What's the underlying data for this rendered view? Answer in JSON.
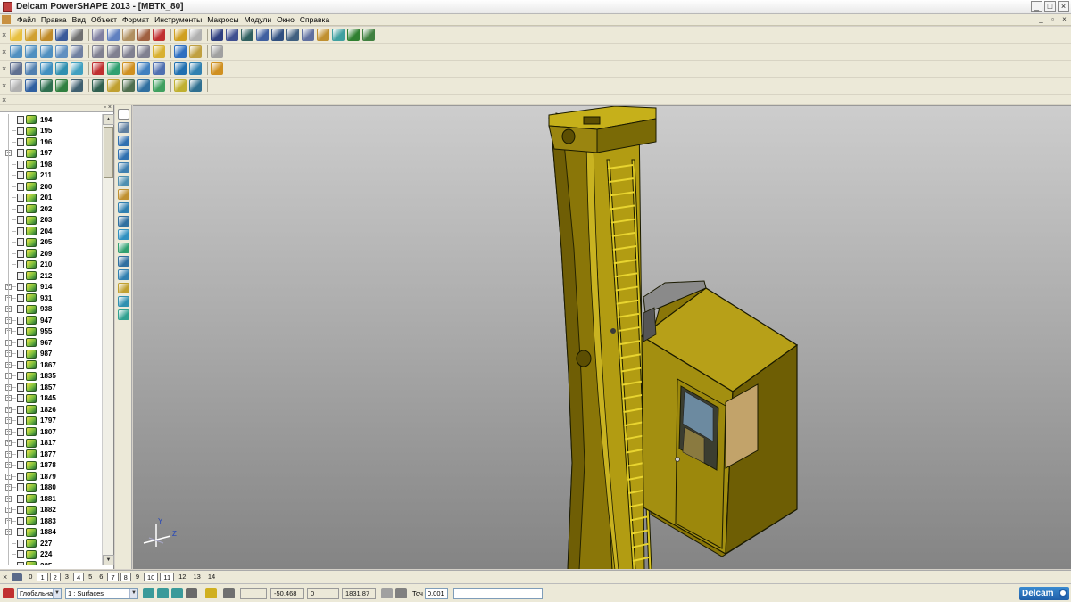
{
  "window": {
    "title": "Delcam PowerSHAPE 2013 - [МВТК_80]",
    "min": "_",
    "max": "□",
    "close": "×"
  },
  "menu": [
    "Файл",
    "Правка",
    "Вид",
    "Объект",
    "Формат",
    "Инструменты",
    "Макросы",
    "Модули",
    "Окно",
    "Справка"
  ],
  "mdi_controls": {
    "min": "_",
    "restore": "▫",
    "close": "×"
  },
  "toolbars": {
    "grip": "×",
    "row1_icons": [
      {
        "name": "new-icon",
        "color": "#e8c040"
      },
      {
        "name": "open-icon",
        "color": "#d0a030"
      },
      {
        "name": "open-recent-icon",
        "color": "#c08a28"
      },
      {
        "name": "save-icon",
        "color": "#3a5a9a"
      },
      {
        "name": "print-icon",
        "color": "#707070"
      },
      {
        "name": "cut-icon",
        "color": "#8080a0"
      },
      {
        "name": "copy-icon",
        "color": "#6080c0"
      },
      {
        "name": "paste-icon",
        "color": "#b09060"
      },
      {
        "name": "brush-icon",
        "color": "#a06040"
      },
      {
        "name": "delete-icon",
        "color": "#c03030"
      },
      {
        "name": "undo-icon",
        "color": "#d0a020"
      },
      {
        "name": "redo-icon",
        "color": "#b0b0b0"
      },
      {
        "name": "workplane-icon",
        "color": "#304080"
      },
      {
        "name": "measure-icon",
        "color": "#405090"
      },
      {
        "name": "axis-icon",
        "color": "#306060"
      },
      {
        "name": "select-icon",
        "color": "#4060a0"
      },
      {
        "name": "circle-icon",
        "color": "#305080"
      },
      {
        "name": "curve-icon",
        "color": "#406080"
      },
      {
        "name": "text-icon",
        "color": "#6070a0"
      },
      {
        "name": "fillet-icon",
        "color": "#c09030"
      },
      {
        "name": "surface-icon",
        "color": "#40a0a0"
      },
      {
        "name": "solid-icon",
        "color": "#308030"
      },
      {
        "name": "tools-icon",
        "color": "#408040"
      }
    ],
    "row2_icons": [
      {
        "name": "view-top-icon",
        "color": "#5090c0"
      },
      {
        "name": "view-front-icon",
        "color": "#5090c0"
      },
      {
        "name": "view-iso-icon",
        "color": "#5090c0"
      },
      {
        "name": "view-iso2-icon",
        "color": "#6090c0"
      },
      {
        "name": "view-fit-icon",
        "color": "#7080a0"
      },
      {
        "name": "zoom-in-icon",
        "color": "#808090"
      },
      {
        "name": "zoom-out-icon",
        "color": "#808090"
      },
      {
        "name": "zoom-box-icon",
        "color": "#808090"
      },
      {
        "name": "zoom-window-icon",
        "color": "#808090"
      },
      {
        "name": "shade-sphere-icon",
        "color": "#d8b030"
      },
      {
        "name": "shade-box-icon",
        "color": "#3070c0"
      },
      {
        "name": "shade-options-icon",
        "color": "#c0a040"
      },
      {
        "name": "hand-icon",
        "color": "#a0a0a0"
      }
    ],
    "row3_icons": [
      {
        "name": "model-tree-icon",
        "color": "#607090"
      },
      {
        "name": "document-icon",
        "color": "#5080b0"
      },
      {
        "name": "wireframe-icon",
        "color": "#4090c0"
      },
      {
        "name": "surface-shade-icon",
        "color": "#3090b0"
      },
      {
        "name": "solid-shade-icon",
        "color": "#40a0c0"
      },
      {
        "name": "red-ball-icon",
        "color": "#c03030"
      },
      {
        "name": "cone-icon",
        "color": "#30a070"
      },
      {
        "name": "cube-icon",
        "color": "#d09020"
      },
      {
        "name": "edges-icon",
        "color": "#4080c0"
      },
      {
        "name": "section-icon",
        "color": "#5070b0"
      },
      {
        "name": "transform-icon",
        "color": "#2070b0"
      },
      {
        "name": "mirror-icon",
        "color": "#3080b0"
      },
      {
        "name": "boolean-icon",
        "color": "#d09020"
      }
    ],
    "row4_icons": [
      {
        "name": "sphere-grey-icon",
        "color": "#b0b0b0"
      },
      {
        "name": "trim-icon",
        "color": "#3060a0"
      },
      {
        "name": "solid-box-icon",
        "color": "#307050"
      },
      {
        "name": "solid-extrude-icon",
        "color": "#308040"
      },
      {
        "name": "solid-revolve-icon",
        "color": "#406070"
      },
      {
        "name": "solid-blend-icon",
        "color": "#306050"
      },
      {
        "name": "solid-shell-icon",
        "color": "#c0a030"
      },
      {
        "name": "solid-pattern-icon",
        "color": "#507050"
      },
      {
        "name": "solid-array-icon",
        "color": "#3070a0"
      },
      {
        "name": "solid-draft-icon",
        "color": "#40a060"
      },
      {
        "name": "solid-fill-icon",
        "color": "#c0b030"
      },
      {
        "name": "solid-cut-icon",
        "color": "#307090"
      }
    ]
  },
  "tree": {
    "items": [
      {
        "label": "194",
        "expandable": false
      },
      {
        "label": "195",
        "expandable": false
      },
      {
        "label": "196",
        "expandable": false
      },
      {
        "label": "197",
        "expandable": true
      },
      {
        "label": "198",
        "expandable": false
      },
      {
        "label": "211",
        "expandable": false
      },
      {
        "label": "200",
        "expandable": false
      },
      {
        "label": "201",
        "expandable": false
      },
      {
        "label": "202",
        "expandable": false
      },
      {
        "label": "203",
        "expandable": false
      },
      {
        "label": "204",
        "expandable": false
      },
      {
        "label": "205",
        "expandable": false
      },
      {
        "label": "209",
        "expandable": false
      },
      {
        "label": "210",
        "expandable": false
      },
      {
        "label": "212",
        "expandable": false
      },
      {
        "label": "914",
        "expandable": true
      },
      {
        "label": "931",
        "expandable": true
      },
      {
        "label": "938",
        "expandable": true
      },
      {
        "label": "947",
        "expandable": true
      },
      {
        "label": "955",
        "expandable": true
      },
      {
        "label": "967",
        "expandable": true
      },
      {
        "label": "987",
        "expandable": true
      },
      {
        "label": "1867",
        "expandable": true
      },
      {
        "label": "1835",
        "expandable": true
      },
      {
        "label": "1857",
        "expandable": true
      },
      {
        "label": "1845",
        "expandable": true
      },
      {
        "label": "1826",
        "expandable": true
      },
      {
        "label": "1797",
        "expandable": true
      },
      {
        "label": "1807",
        "expandable": true
      },
      {
        "label": "1817",
        "expandable": true
      },
      {
        "label": "1877",
        "expandable": true
      },
      {
        "label": "1878",
        "expandable": true
      },
      {
        "label": "1879",
        "expandable": true
      },
      {
        "label": "1880",
        "expandable": true
      },
      {
        "label": "1881",
        "expandable": true
      },
      {
        "label": "1882",
        "expandable": true
      },
      {
        "label": "1883",
        "expandable": true
      },
      {
        "label": "1884",
        "expandable": true
      },
      {
        "label": "227",
        "expandable": false
      },
      {
        "label": "224",
        "expandable": false
      },
      {
        "label": "225",
        "expandable": false
      }
    ]
  },
  "side_toolbar_icons": [
    {
      "name": "pointer-icon",
      "color": "#ffffff"
    },
    {
      "name": "select-filter-icon",
      "color": "#6080a0"
    },
    {
      "name": "copy-layer-icon",
      "color": "#3070b0"
    },
    {
      "name": "duplicate-icon",
      "color": "#3070b0"
    },
    {
      "name": "stack-icon",
      "color": "#4080b0"
    },
    {
      "name": "pen-icon",
      "color": "#5090b0"
    },
    {
      "name": "database-icon",
      "color": "#c09030"
    },
    {
      "name": "drive-icon",
      "color": "#3080b0"
    },
    {
      "name": "disk-icon",
      "color": "#3070a0"
    },
    {
      "name": "image-icon",
      "color": "#3090c0"
    },
    {
      "name": "layers-icon",
      "color": "#30a070"
    },
    {
      "name": "box-open-icon",
      "color": "#3070a0"
    },
    {
      "name": "globe-icon",
      "color": "#3080b0"
    },
    {
      "name": "material-icon",
      "color": "#c0a030"
    },
    {
      "name": "refresh-icon",
      "color": "#3090b0"
    },
    {
      "name": "network-icon",
      "color": "#30a090"
    }
  ],
  "viewport": {
    "axis_labels": {
      "y": "Y",
      "x": "Z"
    }
  },
  "page_tabs": {
    "close": "×",
    "tabs": [
      {
        "label": "0",
        "boxed": false
      },
      {
        "label": "1",
        "boxed": true
      },
      {
        "label": "2",
        "boxed": true
      },
      {
        "label": "3",
        "boxed": false
      },
      {
        "label": "4",
        "boxed": true
      },
      {
        "label": "5",
        "boxed": false
      },
      {
        "label": "6",
        "boxed": false
      },
      {
        "label": "7",
        "boxed": true
      },
      {
        "label": "8",
        "boxed": true
      },
      {
        "label": "9",
        "boxed": false
      },
      {
        "label": "10",
        "boxed": true
      },
      {
        "label": "11",
        "boxed": true
      },
      {
        "label": "12",
        "boxed": false
      },
      {
        "label": "13",
        "boxed": false
      },
      {
        "label": "14",
        "boxed": false
      }
    ]
  },
  "status": {
    "workplane": "Глобальна",
    "level": "1  : Surfaces",
    "coord_x": "-50.468",
    "coord_y": "0",
    "coord_z": "1831.87",
    "tolerance_label": "Точ",
    "tolerance_value": "0.001",
    "logo": "Delcam"
  }
}
